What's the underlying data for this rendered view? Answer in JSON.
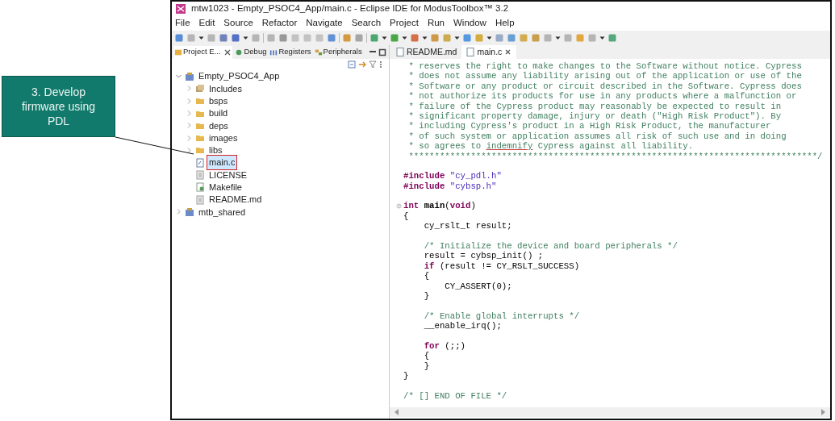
{
  "callout": {
    "text": "3. Develop firmware using PDL"
  },
  "window": {
    "title": "mtw1023 - Empty_PSOC4_App/main.c - Eclipse IDE for ModusToolbox™ 3.2"
  },
  "menu": [
    "File",
    "Edit",
    "Source",
    "Refactor",
    "Navigate",
    "Search",
    "Project",
    "Run",
    "Window",
    "Help"
  ],
  "view_tabs": [
    {
      "label": "Project E...",
      "selected": true,
      "kind": "project"
    },
    {
      "label": "Debug",
      "selected": false,
      "kind": "debug"
    },
    {
      "label": "Registers",
      "selected": false,
      "kind": "registers"
    },
    {
      "label": "Peripherals",
      "selected": false,
      "kind": "peripherals"
    }
  ],
  "tree": [
    {
      "label": "Empty_PSOC4_App",
      "kind": "project",
      "expanded": true,
      "selected": false,
      "children": [
        {
          "label": "Includes",
          "kind": "library",
          "expanded": false,
          "selected": false
        },
        {
          "label": "bsps",
          "kind": "folder",
          "expanded": false,
          "selected": false
        },
        {
          "label": "build",
          "kind": "folder",
          "expanded": false,
          "selected": false
        },
        {
          "label": "deps",
          "kind": "folder",
          "expanded": false,
          "selected": false
        },
        {
          "label": "images",
          "kind": "folder",
          "expanded": false,
          "selected": false
        },
        {
          "label": "libs",
          "kind": "folder",
          "expanded": false,
          "selected": false
        },
        {
          "label": "main.c",
          "kind": "cfile",
          "selected": true
        },
        {
          "label": "LICENSE",
          "kind": "textfile",
          "selected": false
        },
        {
          "label": "Makefile",
          "kind": "makefile",
          "selected": false
        },
        {
          "label": "README.md",
          "kind": "textfile",
          "selected": false
        }
      ]
    },
    {
      "label": "mtb_shared",
      "kind": "project",
      "expanded": false,
      "selected": false
    }
  ],
  "editor_tabs": [
    {
      "label": "README.md",
      "selected": false
    },
    {
      "label": "main.c",
      "selected": true
    }
  ],
  "code": [
    {
      "kind": "code",
      "tokens": [
        {
          "kind": "comment",
          "text": " * reserves the right to make changes to the Software without notice. Cypress"
        }
      ]
    },
    {
      "kind": "code",
      "tokens": [
        {
          "kind": "comment",
          "text": " * does not assume any liability arising out of the application or use of the"
        }
      ]
    },
    {
      "kind": "code",
      "tokens": [
        {
          "kind": "comment",
          "text": " * Software or any product or circuit described in the Software. Cypress does"
        }
      ]
    },
    {
      "kind": "code",
      "tokens": [
        {
          "kind": "comment",
          "text": " * not authorize its products for use in any products where a malfunction or"
        }
      ]
    },
    {
      "kind": "code",
      "tokens": [
        {
          "kind": "comment",
          "text": " * failure of the Cypress product may reasonably be expected to result in"
        }
      ]
    },
    {
      "kind": "code",
      "tokens": [
        {
          "kind": "comment",
          "text": " * significant property damage, injury or death (\"High Risk Product\"). By"
        }
      ]
    },
    {
      "kind": "code",
      "tokens": [
        {
          "kind": "comment",
          "text": " * including Cypress's product in a High Risk Product, the manufacturer"
        }
      ]
    },
    {
      "kind": "code",
      "tokens": [
        {
          "kind": "comment",
          "text": " * of such system or application assumes all risk of such use and in doing"
        }
      ]
    },
    {
      "kind": "code",
      "tokens": [
        {
          "kind": "comment",
          "text": " * so agrees to "
        },
        {
          "kind": "misspelled",
          "text": "indemnify"
        },
        {
          "kind": "comment",
          "text": " Cypress against all liability."
        }
      ]
    },
    {
      "kind": "code",
      "tokens": [
        {
          "kind": "comment",
          "text": " *******************************************************************************/"
        }
      ]
    },
    {
      "kind": "blank"
    },
    {
      "kind": "code",
      "tokens": [
        {
          "kind": "keyword",
          "text": "#include"
        },
        {
          "kind": "string",
          "text": " \"cy_pdl.h\""
        }
      ]
    },
    {
      "kind": "code",
      "tokens": [
        {
          "kind": "keyword",
          "text": "#include"
        },
        {
          "kind": "string",
          "text": " \"cybsp.h\""
        }
      ]
    },
    {
      "kind": "blank"
    },
    {
      "kind": "fold",
      "tokens": [
        {
          "kind": "keyword",
          "text": "int"
        },
        {
          "kind": "function",
          "text": " main"
        },
        {
          "kind": "plain",
          "text": "("
        },
        {
          "kind": "keyword",
          "text": "void"
        },
        {
          "kind": "plain",
          "text": ")"
        }
      ]
    },
    {
      "kind": "code",
      "tokens": [
        {
          "kind": "plain",
          "text": "{"
        }
      ]
    },
    {
      "kind": "code",
      "tokens": [
        {
          "kind": "plain",
          "text": "    cy_rslt_t result;"
        }
      ]
    },
    {
      "kind": "blank"
    },
    {
      "kind": "code",
      "tokens": [
        {
          "kind": "comment",
          "text": "    /* Initialize the device and board peripherals */"
        }
      ]
    },
    {
      "kind": "code",
      "tokens": [
        {
          "kind": "plain",
          "text": "    result = cybsp_init() ;"
        }
      ]
    },
    {
      "kind": "code",
      "tokens": [
        {
          "kind": "keyword",
          "text": "    if"
        },
        {
          "kind": "plain",
          "text": " (result != CY_RSLT_SUCCESS)"
        }
      ]
    },
    {
      "kind": "code",
      "tokens": [
        {
          "kind": "plain",
          "text": "    {"
        }
      ]
    },
    {
      "kind": "code",
      "tokens": [
        {
          "kind": "plain",
          "text": "        CY_ASSERT(0);"
        }
      ]
    },
    {
      "kind": "code",
      "tokens": [
        {
          "kind": "plain",
          "text": "    }"
        }
      ]
    },
    {
      "kind": "blank"
    },
    {
      "kind": "code",
      "tokens": [
        {
          "kind": "comment",
          "text": "    /* Enable global interrupts */"
        }
      ]
    },
    {
      "kind": "code",
      "tokens": [
        {
          "kind": "plain",
          "text": "    __enable_irq();"
        }
      ]
    },
    {
      "kind": "blank"
    },
    {
      "kind": "code",
      "tokens": [
        {
          "kind": "keyword",
          "text": "    for"
        },
        {
          "kind": "plain",
          "text": " (;;)"
        }
      ]
    },
    {
      "kind": "code",
      "tokens": [
        {
          "kind": "plain",
          "text": "    {"
        }
      ]
    },
    {
      "kind": "code",
      "tokens": [
        {
          "kind": "plain",
          "text": "    }"
        }
      ]
    },
    {
      "kind": "code",
      "tokens": [
        {
          "kind": "plain",
          "text": "}"
        }
      ]
    },
    {
      "kind": "blank"
    },
    {
      "kind": "code",
      "tokens": [
        {
          "kind": "comment",
          "text": "/* [] END OF FILE */"
        }
      ]
    }
  ]
}
